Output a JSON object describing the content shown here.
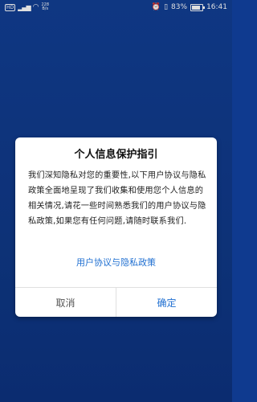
{
  "status_bar": {
    "hd": "HD",
    "signal": "⁴ᴳ",
    "speed_top": "228",
    "speed_bottom": "B/s",
    "icons": [
      "alarm-icon",
      "vibrate-icon"
    ],
    "battery": "83%",
    "time": "16:41"
  },
  "dialog": {
    "title": "个人信息保护指引",
    "body": "我们深知隐私对您的重要性,以下用户协议与隐私政策全面地呈现了我们收集和使用您个人信息的相关情况,请花一些时间熟悉我们的用户协议与隐私政策,如果您有任何问题,请随时联系我们.",
    "link": "用户协议与隐私政策",
    "cancel_label": "取消",
    "confirm_label": "确定"
  },
  "colors": {
    "background": "#123f95",
    "link": "#1f6fd1",
    "dialog_bg": "#ffffff"
  }
}
